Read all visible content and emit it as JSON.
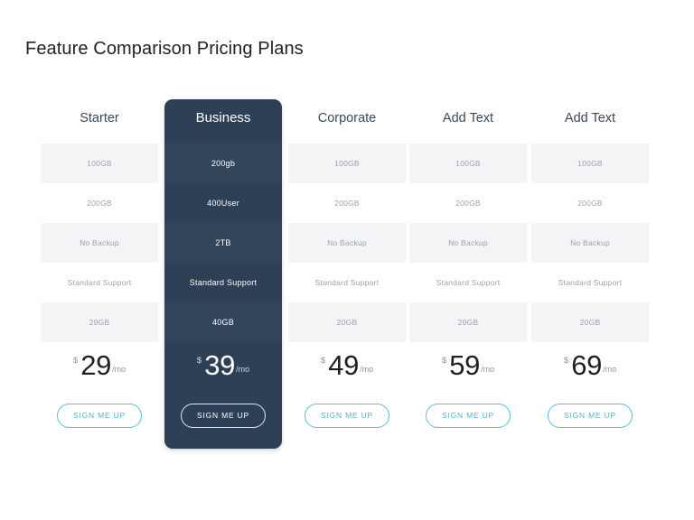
{
  "page": {
    "title": "Feature Comparison Pricing Plans"
  },
  "colors": {
    "accent": "#4fb3cc",
    "featured_background": "#2e4055",
    "row_shade": "#f3f4f5",
    "title": "#222222",
    "feature_text": "#9aa1a9"
  },
  "plans": [
    {
      "name": "Starter",
      "features": [
        "100GB",
        "200GB",
        "No Backup",
        "Standard Support",
        "20GB"
      ],
      "currency": "$",
      "amount": "29",
      "period": "/mo",
      "cta": "SIGN ME UP",
      "featured": false
    },
    {
      "name": "Business",
      "features": [
        "200gb",
        "400User",
        "2TB",
        "Standard Support",
        "40GB"
      ],
      "currency": "$",
      "amount": "39",
      "period": "/mo",
      "cta": "SIGN ME UP",
      "featured": true
    },
    {
      "name": "Corporate",
      "features": [
        "100GB",
        "200GB",
        "No Backup",
        "Standard Support",
        "20GB"
      ],
      "currency": "$",
      "amount": "49",
      "period": "/mo",
      "cta": "SIGN ME UP",
      "featured": false
    },
    {
      "name": "Add Text",
      "features": [
        "100GB",
        "200GB",
        "No Backup",
        "Standard Support",
        "20GB"
      ],
      "currency": "$",
      "amount": "59",
      "period": "/mo",
      "cta": "SIGN ME UP",
      "featured": false
    },
    {
      "name": "Add Text",
      "features": [
        "100GB",
        "200GB",
        "No Backup",
        "Standard Support",
        "20GB"
      ],
      "currency": "$",
      "amount": "69",
      "period": "/mo",
      "cta": "SIGN ME UP",
      "featured": false
    }
  ]
}
